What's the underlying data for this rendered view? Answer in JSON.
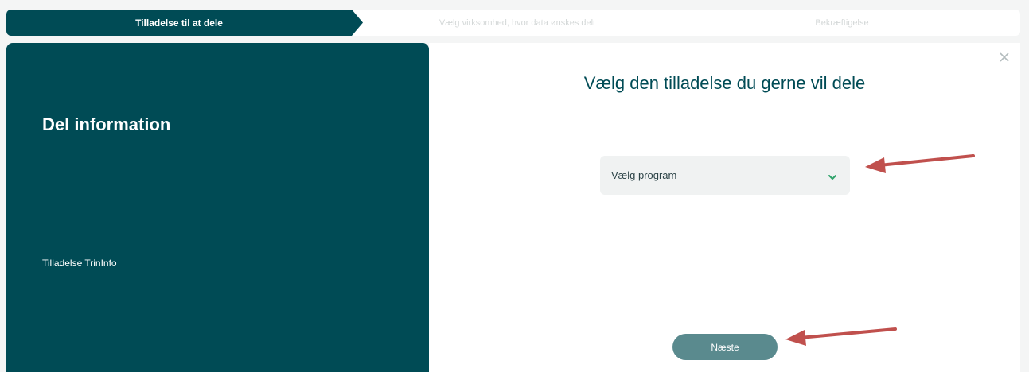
{
  "stepper": {
    "steps": [
      {
        "label": "Tilladelse til at dele",
        "state": "active"
      },
      {
        "label": "Vælg virksomhed, hvor data ønskes delt",
        "state": "inactive"
      },
      {
        "label": "Bekræftigelse",
        "state": "inactive"
      }
    ]
  },
  "left_panel": {
    "title": "Del information",
    "info_text": "Tilladelse TrinInfo"
  },
  "modal": {
    "title": "Vælg den tilladelse du gerne vil dele",
    "close_icon": "close-icon",
    "select": {
      "value": "Vælg program",
      "icon": "chevron-down-icon"
    },
    "next_button": "Næste"
  },
  "colors": {
    "brand_dark": "#004b55",
    "button": "#5a8a8e",
    "chevron": "#2fa36b",
    "annotation_arrow": "#c0504d"
  }
}
